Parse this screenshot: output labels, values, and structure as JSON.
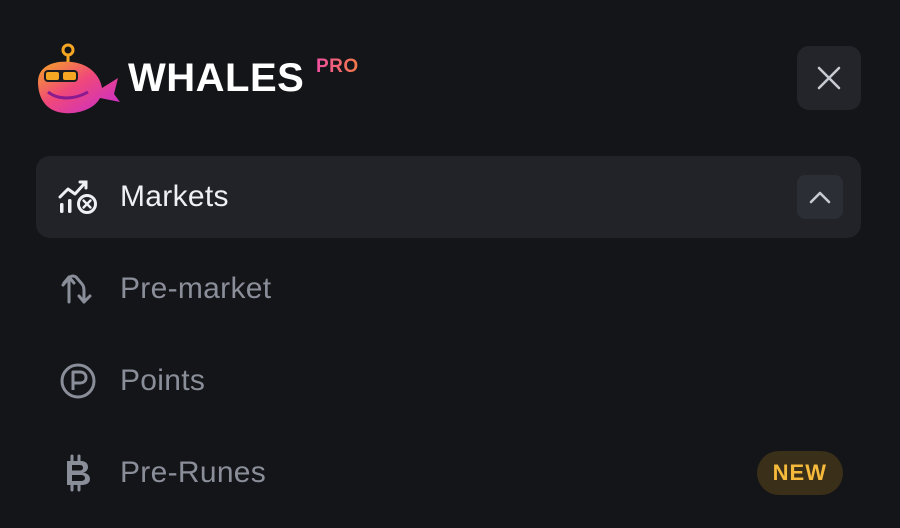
{
  "brand": {
    "name": "WHALES",
    "suffix": "PRO",
    "colors": {
      "gradient_start": "#f04fa0",
      "gradient_end": "#f37a47"
    }
  },
  "header": {
    "close_icon": "close-icon"
  },
  "nav": {
    "items": [
      {
        "label": "Markets",
        "icon": "markets-chart-icon",
        "active": true,
        "expanded": true
      },
      {
        "label": "Pre-market",
        "icon": "swap-arrows-icon",
        "active": false
      },
      {
        "label": "Points",
        "icon": "points-p-icon",
        "active": false
      },
      {
        "label": "Pre-Runes",
        "icon": "bitcoin-icon",
        "active": false,
        "badge": "NEW"
      }
    ]
  },
  "colors": {
    "background": "#141519",
    "active_item": "#222329",
    "badge_text": "#f5b93b",
    "badge_bg": "#3a2f19"
  }
}
